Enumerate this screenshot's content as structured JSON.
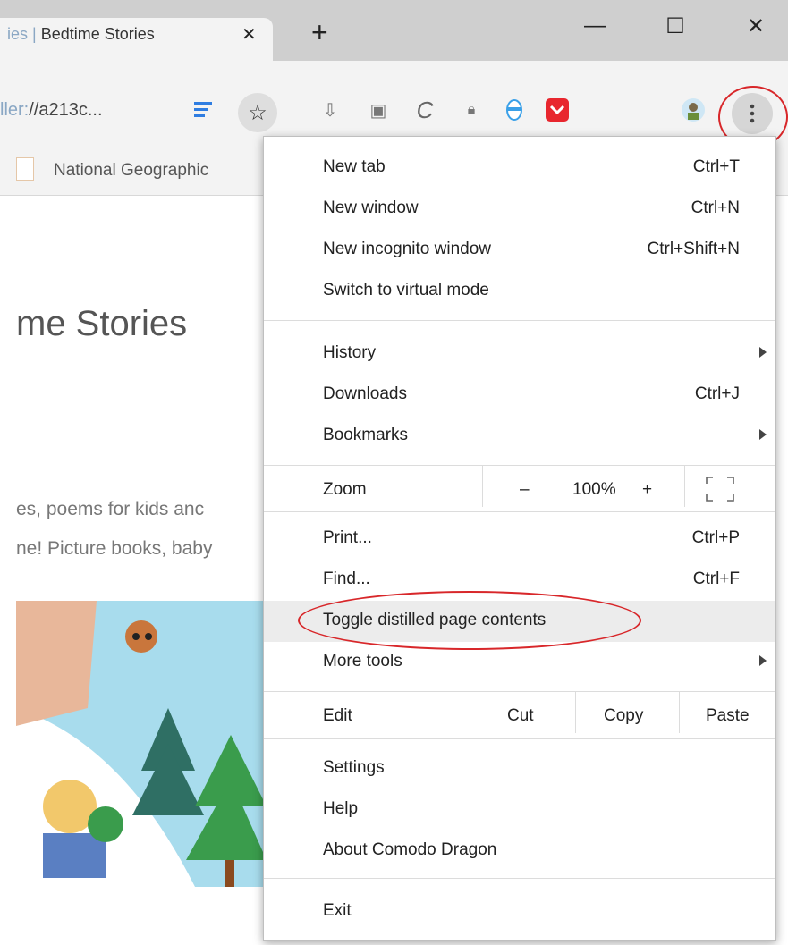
{
  "tab": {
    "title_partial": "ies | ",
    "title": "Bedtime Stories",
    "close_glyph": "✕",
    "new_tab_glyph": "+"
  },
  "window_controls": {
    "minimize": "—",
    "maximize": "☐",
    "close": "✕"
  },
  "address": {
    "url_prefix": "ller:",
    "url": "//a213c..."
  },
  "bookmarks": {
    "items": [
      {
        "label": "National Geographic"
      }
    ]
  },
  "page": {
    "heading": "me Stories",
    "line1": "es, poems for kids anc",
    "line2": "ne! Picture books, baby"
  },
  "menu": {
    "new_tab": {
      "label": "New tab",
      "shortcut": "Ctrl+T"
    },
    "new_window": {
      "label": "New window",
      "shortcut": "Ctrl+N"
    },
    "new_incognito": {
      "label": "New incognito window",
      "shortcut": "Ctrl+Shift+N"
    },
    "virtual_mode": {
      "label": "Switch to virtual mode"
    },
    "history": {
      "label": "History"
    },
    "downloads": {
      "label": "Downloads",
      "shortcut": "Ctrl+J"
    },
    "bookmarks": {
      "label": "Bookmarks"
    },
    "zoom": {
      "label": "Zoom",
      "minus": "–",
      "value": "100%",
      "plus": "+"
    },
    "print": {
      "label": "Print...",
      "shortcut": "Ctrl+P"
    },
    "find": {
      "label": "Find...",
      "shortcut": "Ctrl+F"
    },
    "toggle_distilled": {
      "label": "Toggle distilled page contents"
    },
    "more_tools": {
      "label": "More tools"
    },
    "edit": {
      "label": "Edit",
      "cut": "Cut",
      "copy": "Copy",
      "paste": "Paste"
    },
    "settings": {
      "label": "Settings"
    },
    "help": {
      "label": "Help"
    },
    "about": {
      "label": "About Comodo Dragon"
    },
    "exit": {
      "label": "Exit"
    }
  },
  "colors": {
    "highlight_ring": "#d8272a",
    "menu_hover": "#ececec"
  }
}
